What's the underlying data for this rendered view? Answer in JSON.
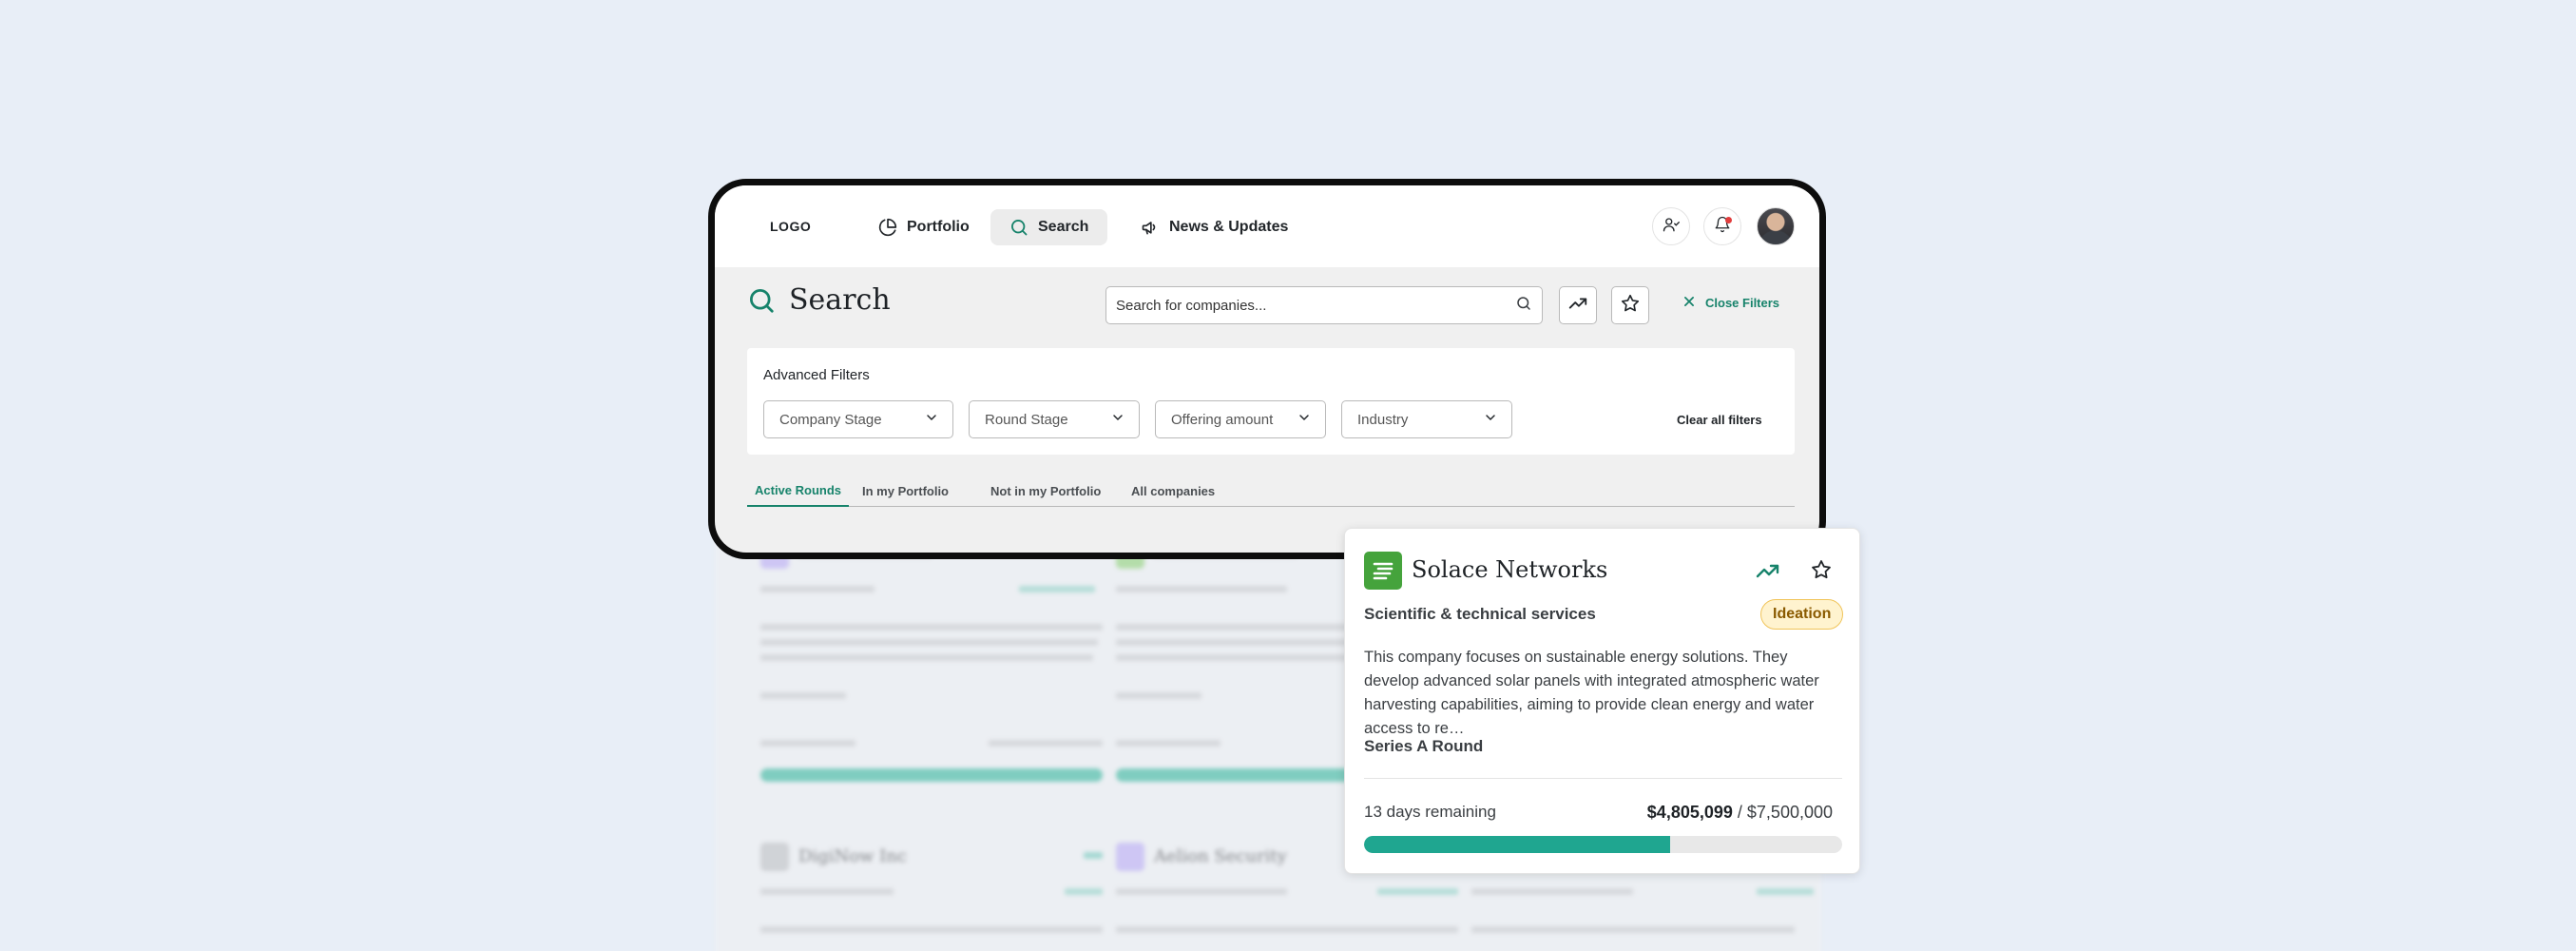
{
  "nav": {
    "logo": "LOGO",
    "items": [
      {
        "label": "Portfolio",
        "icon": "pie-chart-icon"
      },
      {
        "label": "Search",
        "icon": "search-icon",
        "active": true
      },
      {
        "label": "News & Updates",
        "icon": "megaphone-icon"
      }
    ],
    "notification_dot_color": "#e23d3d"
  },
  "search": {
    "title": "Search",
    "placeholder": "Search for companies...",
    "close_filters_label": "Close Filters"
  },
  "filters": {
    "title": "Advanced Filters",
    "dropdowns": [
      "Company Stage",
      "Round Stage",
      "Offering amount",
      "Industry"
    ],
    "clear_label": "Clear all filters"
  },
  "tabs": [
    {
      "label": "Active Rounds",
      "active": true
    },
    {
      "label": "In my Portfolio"
    },
    {
      "label": "Not in my Portfolio"
    },
    {
      "label": "All companies"
    }
  ],
  "background_cards": [
    {
      "name": "DigiNow Inc"
    },
    {
      "name": "Aelion Security"
    }
  ],
  "popup": {
    "company_name": "Solace Networks",
    "industry": "Scientific & technical services",
    "stage": "Ideation",
    "description": "This company focuses on sustainable energy solutions. They develop advanced solar panels with integrated atmospheric water harvesting capabilities, aiming to provide clean energy and water access to re…",
    "round": "Series A Round",
    "remaining": "13 days remaining",
    "raised": "$4,805,099",
    "separator": " / ",
    "target": "$7,500,000",
    "progress_fraction": 0.64,
    "accent_color": "#1fa690",
    "badge_color": "#fff3cf"
  }
}
